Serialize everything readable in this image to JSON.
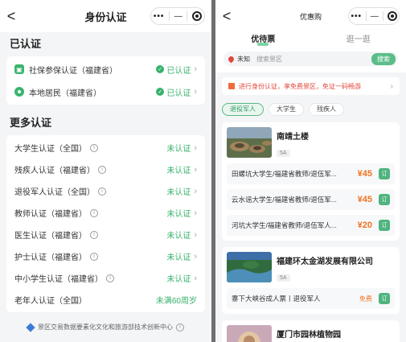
{
  "left": {
    "nav": {
      "back": "<",
      "title": "身份认证",
      "capsule_more": "•••",
      "capsule_min": "—"
    },
    "verified": {
      "title": "已认证",
      "items": [
        {
          "label": "社保参保认证（福建省）",
          "status": "已认证",
          "icon": "id-card-icon"
        },
        {
          "label": "本地居民（福建省）",
          "status": "已认证",
          "icon": "location-pin-icon"
        }
      ]
    },
    "more": {
      "title": "更多认证",
      "items": [
        {
          "label": "大学生认证（全国）",
          "status": "未认证"
        },
        {
          "label": "残疾人认证（福建省）",
          "status": "未认证"
        },
        {
          "label": "退役军人认证（全国）",
          "status": "未认证"
        },
        {
          "label": "教师认证（福建省）",
          "status": "未认证"
        },
        {
          "label": "医生认证（福建省）",
          "status": "未认证"
        },
        {
          "label": "护士认证（福建省）",
          "status": "未认证"
        },
        {
          "label": "中小学生认证（福建省）",
          "status": "未认证"
        },
        {
          "label": "老年人认证（全国）",
          "status": "未满60周岁"
        }
      ]
    },
    "footer": "景区交易数据要素化文化和旅游部技术创新中心"
  },
  "right": {
    "nav": {
      "back": "<",
      "title": "优惠购",
      "capsule_more": "•••",
      "capsule_min": "—"
    },
    "tabs": [
      "优待票",
      "逛一逛"
    ],
    "search": {
      "city": "未知",
      "placeholder": "搜索景区",
      "button": "搜索"
    },
    "banner": "进行身份认证，享免费景区，免证一码畅游",
    "chips": [
      "退役军人",
      "大学生",
      "残疾人"
    ],
    "venues": [
      {
        "name": "南靖土楼",
        "grade": "5A",
        "tickets": [
          {
            "name": "田螺坑大学生/福建省教师/退伍军...",
            "price": "¥45",
            "book": "订"
          },
          {
            "name": "云水谣大学生/福建省教师/退伍军...",
            "price": "¥45",
            "book": "订"
          },
          {
            "name": "河坑大学生/福建省教师/退伍军人...",
            "price": "¥20",
            "book": "订"
          }
        ]
      },
      {
        "name": "福建环太金湖发展有限公司",
        "grade": "5A",
        "tickets": [
          {
            "name": "寨下大峡谷成人票丨退役军人",
            "price": "免费",
            "book": "订"
          }
        ]
      },
      {
        "name": "厦门市园林植物园"
      }
    ]
  },
  "colors": {
    "accent_green": "#37b26c",
    "price_orange": "#f0731f",
    "banner_red": "#e2473a"
  }
}
